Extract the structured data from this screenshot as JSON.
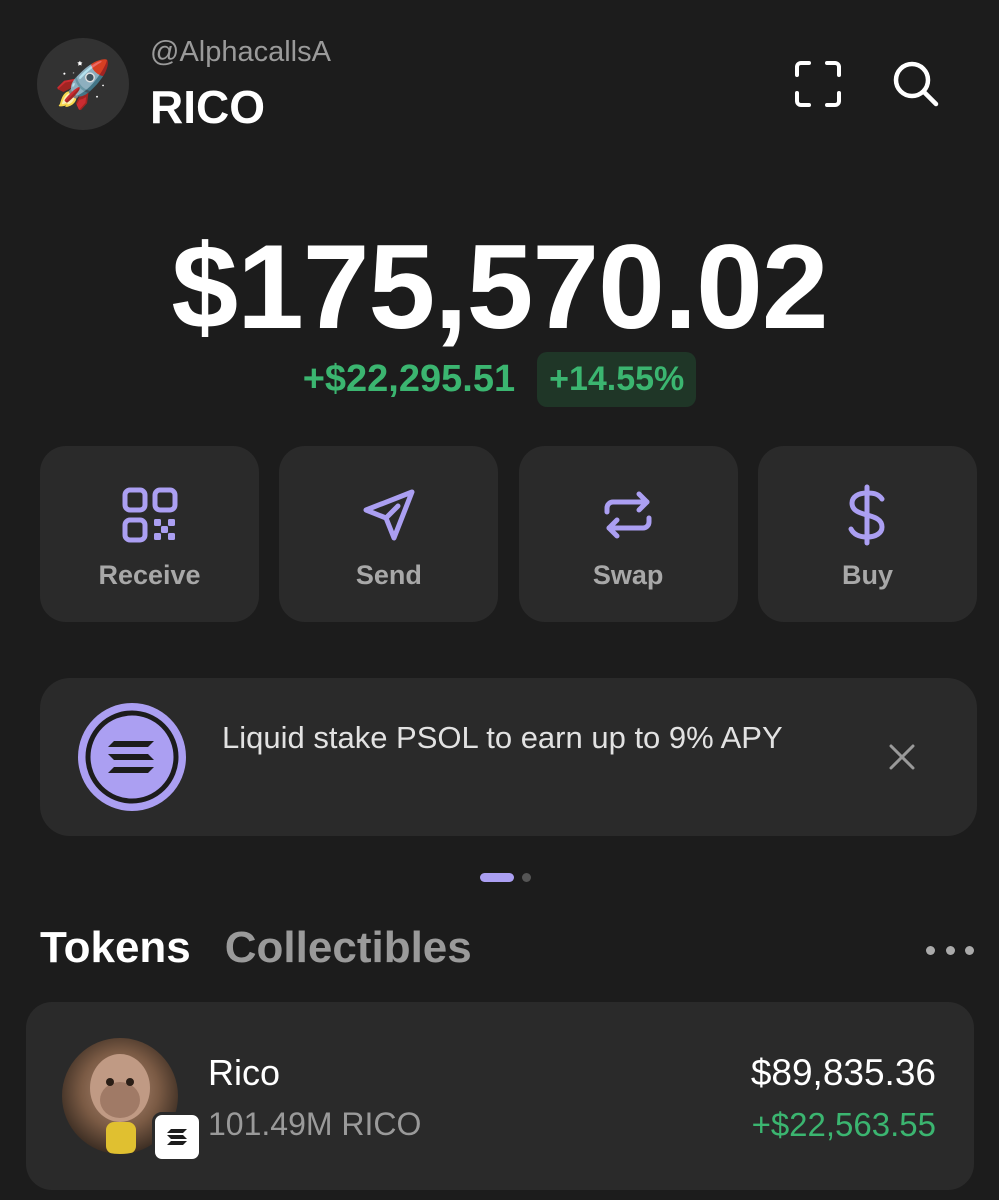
{
  "header": {
    "avatar_emoji": "🚀",
    "handle": "@AlphacallsA",
    "account_name": "RICO",
    "icons": [
      "scan-icon",
      "search-icon"
    ]
  },
  "balance": {
    "total": "$175,570.02",
    "change_abs": "+$22,295.51",
    "change_pct": "+14.55%"
  },
  "actions": [
    {
      "label": "Receive",
      "icon": "qr-code-icon"
    },
    {
      "label": "Send",
      "icon": "send-icon"
    },
    {
      "label": "Swap",
      "icon": "swap-icon"
    },
    {
      "label": "Buy",
      "icon": "dollar-icon"
    }
  ],
  "banner": {
    "text": "Liquid stake PSOL to earn up to 9% APY",
    "icon": "solana-logo-icon"
  },
  "pager": {
    "pages": 2,
    "active": 1
  },
  "tabs": {
    "tokens": "Tokens",
    "collectibles": "Collectibles"
  },
  "tokens": [
    {
      "name": "Rico",
      "amount": "101.49M RICO",
      "value": "$89,835.36",
      "change": "+$22,563.55"
    }
  ],
  "colors": {
    "background": "#1c1c1c",
    "card": "#2a2a2a",
    "accent": "#ab9ff2",
    "positive": "#3bb570"
  }
}
